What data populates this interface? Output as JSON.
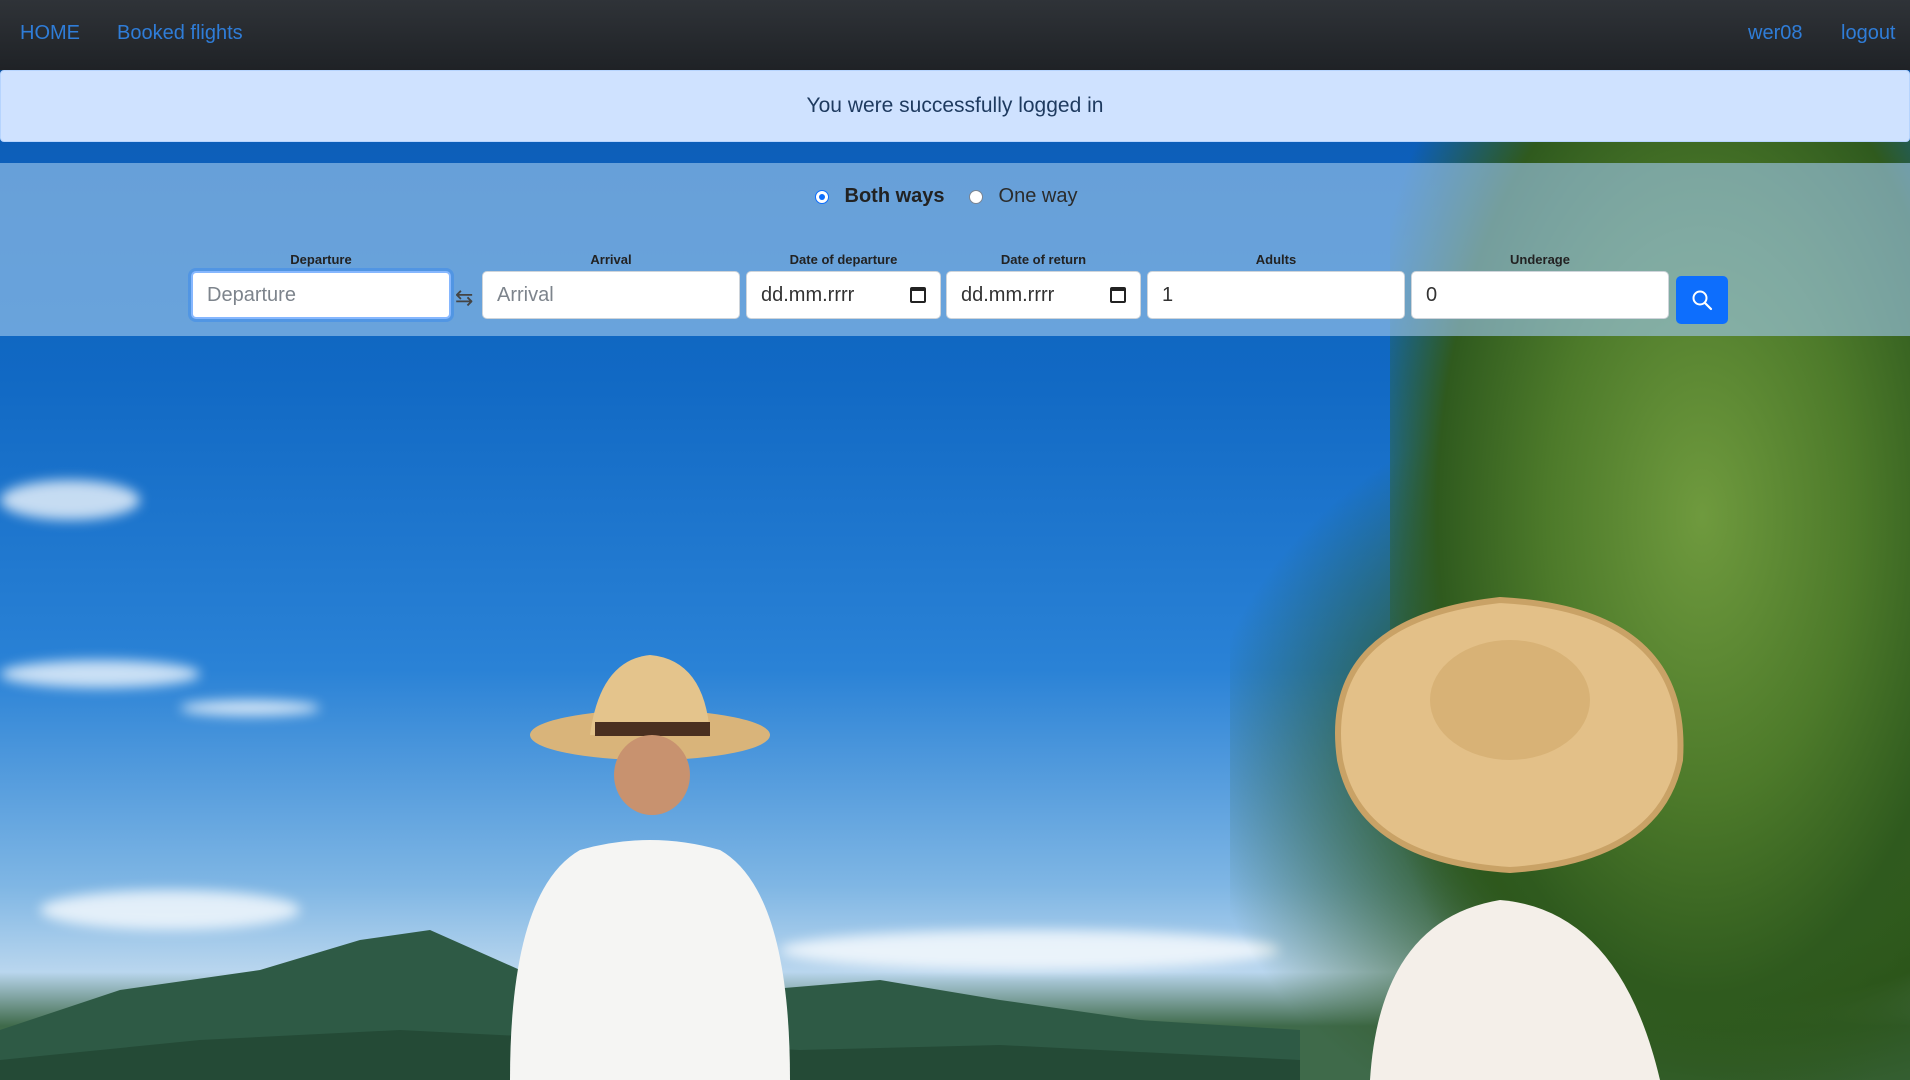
{
  "navbar": {
    "home": "HOME",
    "booked": "Booked flights",
    "user": "wer08",
    "logout": "logout"
  },
  "alert": {
    "message": "You were successfully logged in"
  },
  "trip": {
    "both_ways": "Both ways",
    "one_way": "One way",
    "selected": "Both ways"
  },
  "search": {
    "departure": {
      "label": "Departure",
      "placeholder": "Departure"
    },
    "arrival": {
      "label": "Arrival",
      "placeholder": "Arrival"
    },
    "date_departure": {
      "label": "Date of departure",
      "value": "dd.mm.rrrr"
    },
    "date_return": {
      "label": "Date of return",
      "value": "dd.mm.rrrr"
    },
    "adults": {
      "label": "Adults",
      "value": "1"
    },
    "underage": {
      "label": "Underage",
      "value": "0"
    }
  },
  "icons": {
    "swap": "swap-arrows-icon",
    "search": "search-icon",
    "calendar": "calendar-icon"
  },
  "colors": {
    "accent": "#0d6efd",
    "nav_link": "#2f7dd8",
    "alert_bg": "#cfe2ff"
  }
}
